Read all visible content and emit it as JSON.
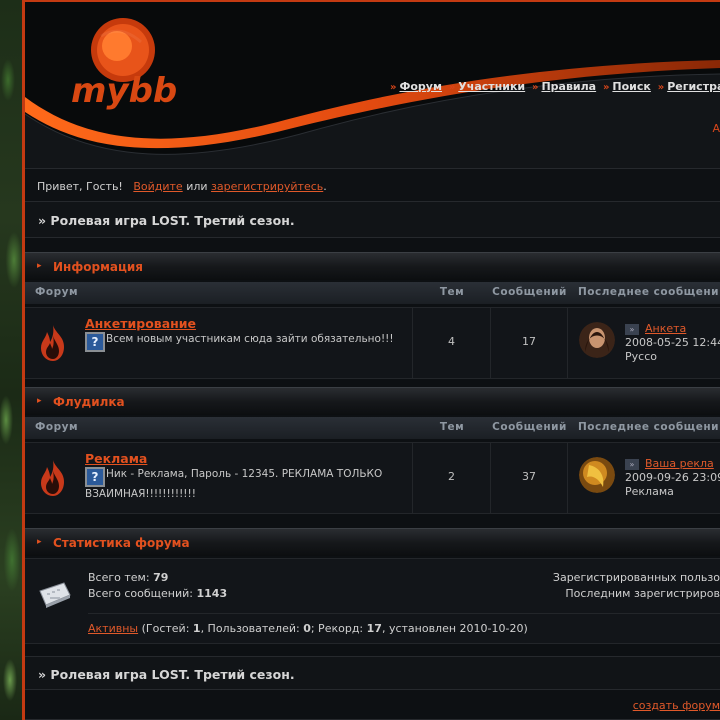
{
  "header": {
    "logo_text": "mybb",
    "nav": [
      {
        "label": "Форум"
      },
      {
        "label": "Участники"
      },
      {
        "label": "Правила"
      },
      {
        "label": "Поиск"
      },
      {
        "label": "Регистра"
      }
    ],
    "right_char": "А"
  },
  "greeting": {
    "prefix": "Привет, Гость!",
    "login": "Войдите",
    "or": "или",
    "register": "зарегистрируйтесь",
    "suffix": "."
  },
  "breadcrumb": "» Ролевая игра LOST. Третий сезон.",
  "columns": {
    "forum": "Форум",
    "topics": "Тем",
    "posts": "Сообщений",
    "last": "Последнее сообщени"
  },
  "categories": [
    {
      "title": "Информация",
      "forums": [
        {
          "title": "Анкетирование",
          "desc": "Всем новым участникам сюда зайти обязательно!!!",
          "topics": "4",
          "posts": "17",
          "last_topic": "Анкета",
          "last_date": "2008-05-25 12:44",
          "last_user": "Руссо"
        }
      ]
    },
    {
      "title": "Флудилка",
      "forums": [
        {
          "title": "Реклама",
          "desc": "Ник - Реклама, Пароль - 12345. РЕКЛАМА ТОЛЬКО ВЗАИМНАЯ!!!!!!!!!!!!",
          "topics": "2",
          "posts": "37",
          "last_topic": "Ваша рекла",
          "last_date": "2009-09-26 23:09",
          "last_user": "Реклама"
        }
      ]
    }
  ],
  "stats": {
    "title": "Статистика форума",
    "topics_label": "Всего тем:",
    "topics_value": "79",
    "posts_label": "Всего сообщений:",
    "posts_value": "1143",
    "registered_label": "Зарегистрированных пользо",
    "last_registered_label": "Последним зарегистриров",
    "online_link": "Активны",
    "online_open": "(Гостей:",
    "guests": "1",
    "users_label": ", Пользователей:",
    "users": "0",
    "record_label": "; Рекорд:",
    "record": "17",
    "record_date": ", установлен 2010-10-20)"
  },
  "footer": {
    "create_forum": "создать форум"
  },
  "colors": {
    "accent": "#e2511f",
    "bg": "#0d1013",
    "border": "#c33a12"
  }
}
